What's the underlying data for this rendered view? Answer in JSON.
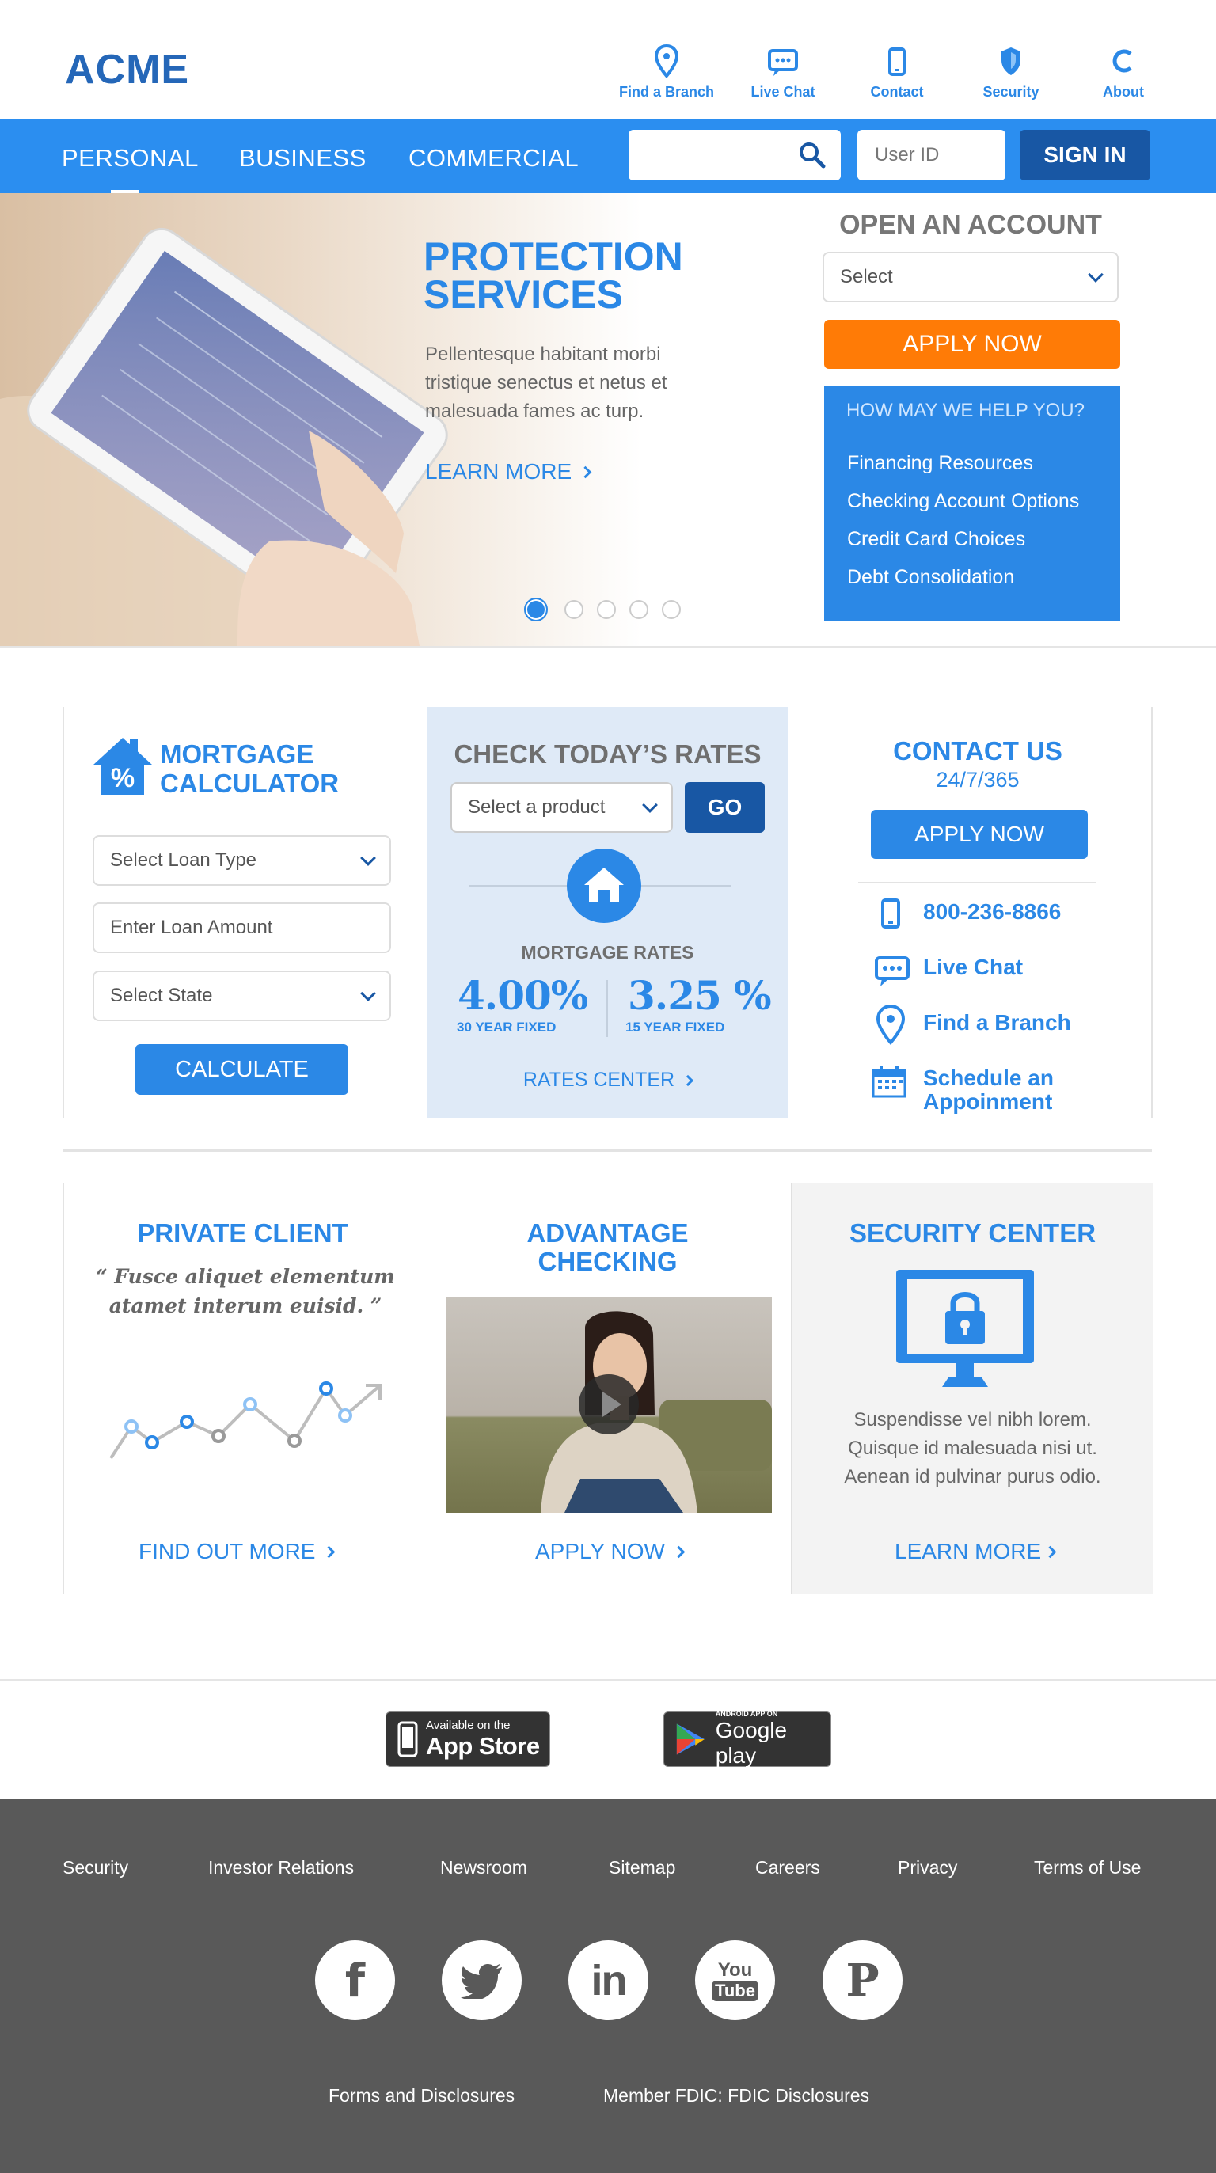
{
  "brand": {
    "logo": "ACME"
  },
  "topnav": [
    {
      "label": "Find a Branch",
      "icon": "map-pin-icon"
    },
    {
      "label": "Live Chat",
      "icon": "chat-icon"
    },
    {
      "label": "Contact",
      "icon": "phone-icon"
    },
    {
      "label": "Security",
      "icon": "shield-icon"
    },
    {
      "label": "About",
      "icon": "about-icon"
    }
  ],
  "mainnav": [
    "PERSONAL",
    "BUSINESS",
    "COMMERCIAL"
  ],
  "login": {
    "search_value": "",
    "userid_placeholder": "User ID",
    "signin_label": "SIGN IN"
  },
  "hero": {
    "title_line1": "PROTECTION",
    "title_line2": "SERVICES",
    "text": "Pellentesque habitant morbi tristique senectus et netus et malesuada fames ac turp.",
    "link": "LEARN MORE",
    "slides_total": 5,
    "active_slide": 1
  },
  "account": {
    "title": "OPEN AN ACCOUNT",
    "select_value": "Select",
    "apply_label": "APPLY NOW",
    "help_title": "HOW MAY WE HELP YOU?",
    "help_items": [
      "Financing Resources",
      "Checking Account Options",
      "Credit Card Choices",
      "Debt Consolidation"
    ]
  },
  "mortgage": {
    "title_line1": "MORTGAGE",
    "title_line2": "CALCULATOR",
    "loan_type": "Select Loan Type",
    "loan_amount_placeholder": "Enter Loan Amount",
    "state": "Select State",
    "calculate_label": "CALCULATE"
  },
  "rates": {
    "title": "CHECK TODAY’S RATES",
    "product_select": "Select a product",
    "go_label": "GO",
    "label": "MORTGAGE RATES",
    "rate30": "4.00%",
    "rate30_label": "30 YEAR FIXED",
    "rate15": "3.25 %",
    "rate15_label": "15 YEAR FIXED",
    "center_link": "RATES CENTER"
  },
  "contact": {
    "title": "CONTACT US",
    "hours": "24/7/365",
    "apply_label": "APPLY NOW",
    "phone": "800-236-8866",
    "chat": "Live Chat",
    "branch": "Find a Branch",
    "schedule_line1": "Schedule an",
    "schedule_line2": "Appoinment"
  },
  "private": {
    "title": "PRIVATE CLIENT",
    "quote_line1": "“ Fusce aliquet elementum",
    "quote_line2": "atamet interum euisid. ”",
    "link": "FIND OUT MORE"
  },
  "advantage": {
    "title_line1": "ADVANTAGE",
    "title_line2": "CHECKING",
    "link": "APPLY NOW"
  },
  "security": {
    "title": "SECURITY CENTER",
    "text_line1": "Suspendisse vel nibh lorem.",
    "text_line2": "Quisque id malesuada nisi ut.",
    "text_line3": "Aenean id pulvinar purus odio.",
    "link": "LEARN MORE"
  },
  "apps": {
    "appstore_small": "Available on the",
    "appstore_big": "App Store",
    "google_small": "ANDROID APP ON",
    "google_big": "Google play"
  },
  "footer": {
    "links": [
      "Security",
      "Investor Relations",
      "Newsroom",
      "Sitemap",
      "Careers",
      "Privacy",
      "Terms of Use"
    ],
    "social": [
      "facebook-icon",
      "twitter-icon",
      "linkedin-icon",
      "youtube-icon",
      "pinterest-icon"
    ],
    "linkedin_text": "in",
    "youtube_top": "You",
    "youtube_bottom": "Tube",
    "facebook_text": "f",
    "pinterest_text": "P",
    "legal": [
      "Forms and Disclosures",
      "Member FDIC: FDIC Disclosures"
    ]
  },
  "colors": {
    "primary": "#2b88e6",
    "nav_blue": "#2b8ef0",
    "dark_blue": "#1857a4",
    "orange": "#ff7b06",
    "footer": "#595959"
  }
}
